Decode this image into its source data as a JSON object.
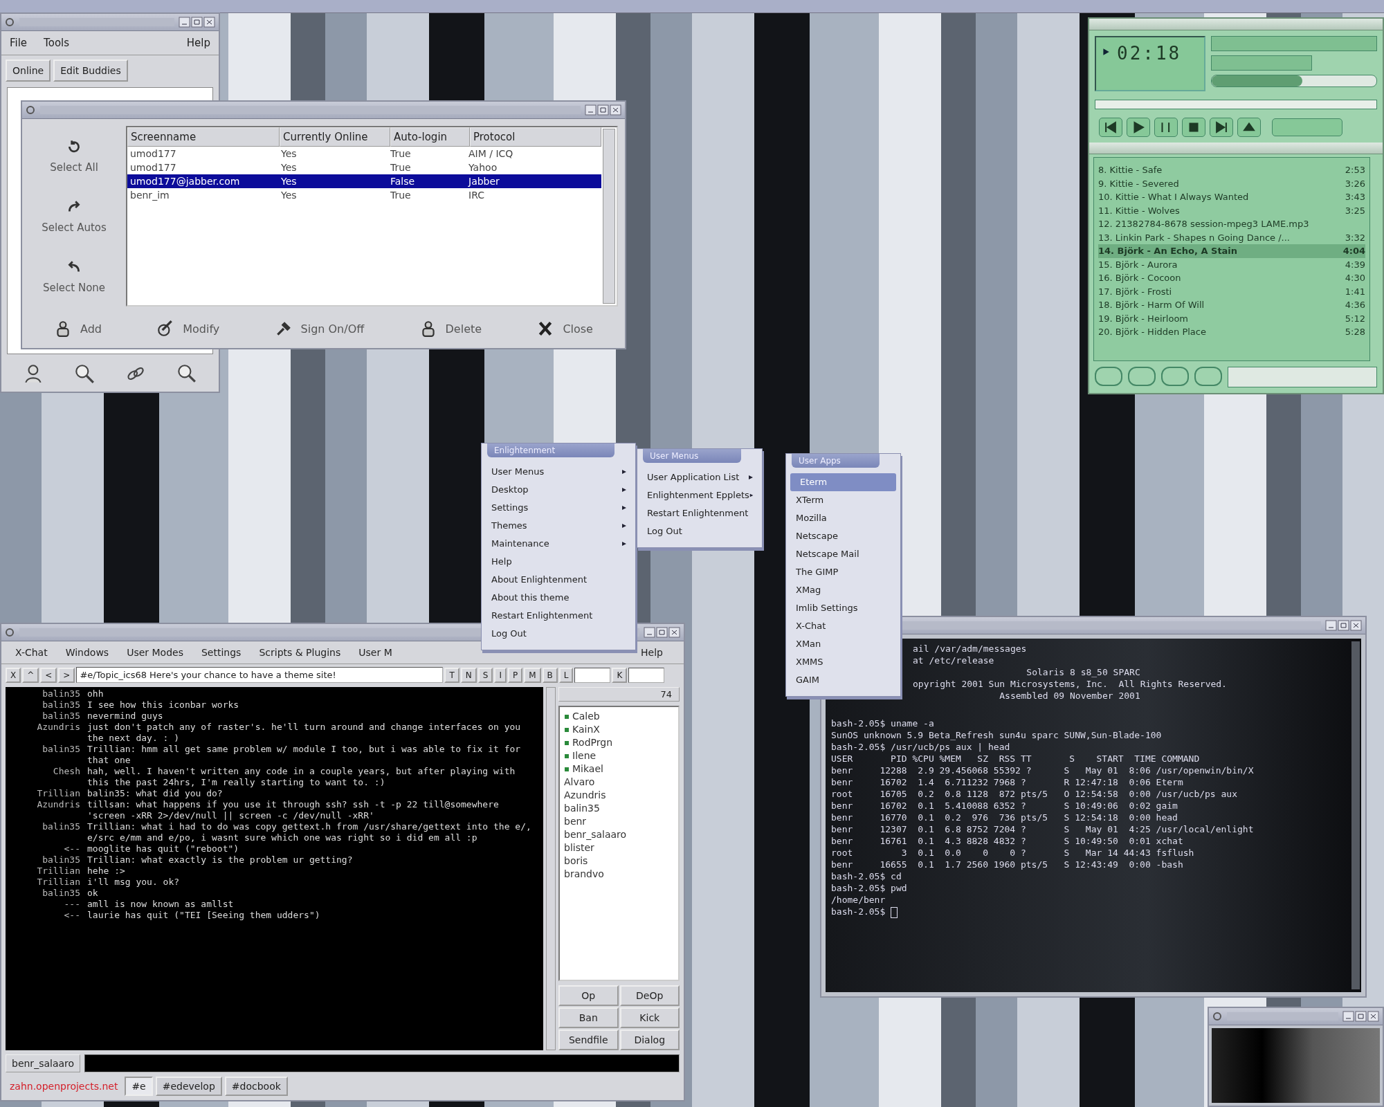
{
  "buddy_list": {
    "menu": [
      "File",
      "Tools",
      "Help"
    ],
    "buttons": [
      "Online",
      "Edit Buddies"
    ]
  },
  "account_editor": {
    "side_buttons": [
      "Select All",
      "Select Autos",
      "Select None"
    ],
    "columns": [
      "Screenname",
      "Currently Online",
      "Auto-login",
      "Protocol"
    ],
    "rows": [
      {
        "cells": [
          "umod177",
          "Yes",
          "True",
          "AIM / ICQ"
        ],
        "selected": false
      },
      {
        "cells": [
          "umod177",
          "Yes",
          "True",
          "Yahoo"
        ],
        "selected": false
      },
      {
        "cells": [
          "umod177@jabber.com",
          "Yes",
          "False",
          "Jabber"
        ],
        "selected": true
      },
      {
        "cells": [
          "benr_im",
          "Yes",
          "True",
          "IRC"
        ],
        "selected": false
      }
    ],
    "buttons": [
      "Add",
      "Modify",
      "Sign On/Off",
      "Delete",
      "Close"
    ]
  },
  "player": {
    "time": "02:18",
    "volume": {
      "level": 0.55
    },
    "playlist": [
      {
        "title": "8. Kittie - Safe",
        "length": "2:53",
        "selected": false
      },
      {
        "title": "9. Kittie - Severed",
        "length": "3:26",
        "selected": false
      },
      {
        "title": "10. Kittie - What I Always Wanted",
        "length": "3:43",
        "selected": false
      },
      {
        "title": "11. Kittie - Wolves",
        "length": "3:25",
        "selected": false
      },
      {
        "title": "12. 21382784-8678 session-mpeg3 LAME.mp3",
        "selected": false
      },
      {
        "title": "13. Linkin Park - Shapes n Going Dance /...",
        "length": "3:32",
        "selected": false
      },
      {
        "title": "14. Björk - An Echo, A Stain",
        "length": "4:04",
        "selected": true
      },
      {
        "title": "15. Björk - Aurora",
        "length": "4:39",
        "selected": false
      },
      {
        "title": "16. Björk - Cocoon",
        "length": "4:30",
        "selected": false
      },
      {
        "title": "17. Björk - Frosti",
        "length": "1:41",
        "selected": false
      },
      {
        "title": "18. Björk - Harm Of Will",
        "length": "4:36",
        "selected": false
      },
      {
        "title": "19. Björk - Heirloom",
        "length": "5:12",
        "selected": false
      },
      {
        "title": "20. Björk - Hidden Place",
        "length": "5:28",
        "selected": false
      }
    ]
  },
  "menus": [
    {
      "title": "Enlightenment",
      "items": [
        {
          "label": "User Menus",
          "has_submenu": true,
          "selected": false
        },
        {
          "label": "Desktop",
          "has_submenu": true,
          "selected": false
        },
        {
          "label": "Settings",
          "has_submenu": true,
          "selected": false
        },
        {
          "label": "Themes",
          "has_submenu": true,
          "selected": false
        },
        {
          "label": "Maintenance",
          "has_submenu": true,
          "selected": false
        },
        {
          "label": "Help",
          "has_submenu": false,
          "selected": false
        },
        {
          "label": "About Enlightenment",
          "has_submenu": false,
          "selected": false
        },
        {
          "label": "About this theme",
          "has_submenu": false,
          "selected": false
        },
        {
          "label": "Restart Enlightenment",
          "has_submenu": false,
          "selected": false
        },
        {
          "label": "Log Out",
          "has_submenu": false,
          "selected": false
        }
      ]
    },
    {
      "title": "User Menus",
      "items": [
        {
          "label": "User Application List",
          "has_submenu": true,
          "selected": false
        },
        {
          "label": "Enlightenment Epplets",
          "has_submenu": true,
          "selected": false
        },
        {
          "label": "Restart Enlightenment",
          "has_submenu": false,
          "selected": false
        },
        {
          "label": "Log Out",
          "has_submenu": false,
          "selected": false
        }
      ]
    },
    {
      "title": "User Apps",
      "items": [
        {
          "label": "Eterm",
          "has_submenu": false,
          "selected": true
        },
        {
          "label": "XTerm",
          "has_submenu": false,
          "selected": false
        },
        {
          "label": "Mozilla",
          "has_submenu": false,
          "selected": false
        },
        {
          "label": "Netscape",
          "has_submenu": false,
          "selected": false
        },
        {
          "label": "Netscape Mail",
          "has_submenu": false,
          "selected": false
        },
        {
          "label": "The GIMP",
          "has_submenu": false,
          "selected": false
        },
        {
          "label": "XMag",
          "has_submenu": false,
          "selected": false
        },
        {
          "label": "Imlib Settings",
          "has_submenu": false,
          "selected": false
        },
        {
          "label": "X-Chat",
          "has_submenu": false,
          "selected": false
        },
        {
          "label": "XMan",
          "has_submenu": false,
          "selected": false
        },
        {
          "label": "XMMS",
          "has_submenu": false,
          "selected": false
        },
        {
          "label": "GAIM",
          "has_submenu": false,
          "selected": false
        }
      ]
    }
  ],
  "xchat": {
    "menu": [
      "X-Chat",
      "Windows",
      "User Modes",
      "Settings",
      "Scripts & Plugins",
      "User M"
    ],
    "help": "Help",
    "nav_buttons": [
      "X",
      "^",
      "<",
      ">"
    ],
    "topic": "#e/Topic_ics68   Here's your chance to have a theme site!",
    "mode_buttons": [
      "T",
      "N",
      "S",
      "I",
      "P",
      "M",
      "B",
      "L"
    ],
    "key_button": "K",
    "messages": [
      {
        "nick": "balin35",
        "text": "ohh"
      },
      {
        "nick": "balin35",
        "text": "I see how this iconbar works"
      },
      {
        "nick": "balin35",
        "text": "nevermind guys"
      },
      {
        "nick": "Azundris",
        "text": "just don't patch any of raster's. he'll turn around and change interfaces on you the next day. : )"
      },
      {
        "nick": "balin35",
        "text": "Trillian: hmm all get same problem w/ module I too, but i was able to fix it for that one"
      },
      {
        "nick": "Chesh",
        "text": "hah, well. I haven't written any code in a couple years, but after playing with this the past 24hrs, I'm really starting to want to. :)"
      },
      {
        "nick": "Trillian",
        "text": "balin35: what did you do?"
      },
      {
        "nick": "Azundris",
        "text": "tillsan: what happens if you use it through ssh?  ssh -t -p 22 till@somewhere 'screen -xRR 2>/dev/null || screen -c /dev/null -xRR'"
      },
      {
        "nick": "balin35",
        "text": "Trillian: what i had to do was copy gettext.h from /usr/share/gettext into the e/, e/src e/mm and e/po, i wasnt sure which one was right so i did em all :p"
      },
      {
        "nick": "<--",
        "text": "mooglite has quit (\"reboot\")"
      },
      {
        "nick": "balin35",
        "text": "Trillian: what exactly is the problem ur getting?"
      },
      {
        "nick": "Trillian",
        "text": "hehe :>"
      },
      {
        "nick": "Trillian",
        "text": "i'll msg you. ok?"
      },
      {
        "nick": "balin35",
        "text": "ok"
      },
      {
        "nick": "---",
        "text": "amll is now known as amllst"
      },
      {
        "nick": "<--",
        "text": "laurie has quit (\"TEI [Seeing them udders\")"
      }
    ],
    "user_count": "74",
    "users": [
      {
        "name": "Caleb",
        "op": true
      },
      {
        "name": "KainX",
        "op": true
      },
      {
        "name": "RodPrgn",
        "op": true
      },
      {
        "name": "Ilene",
        "op": true
      },
      {
        "name": "Mikael",
        "op": true
      },
      {
        "name": "Alvaro",
        "op": false
      },
      {
        "name": "Azundris",
        "op": false
      },
      {
        "name": "balin35",
        "op": false
      },
      {
        "name": "benr",
        "op": false
      },
      {
        "name": "benr_salaaro",
        "op": false
      },
      {
        "name": "blister",
        "op": false
      },
      {
        "name": "boris",
        "op": false
      },
      {
        "name": "brandvo",
        "op": false
      }
    ],
    "user_buttons": [
      "Op",
      "DeOp",
      "Ban",
      "Kick",
      "Sendfile",
      "Dialog"
    ],
    "nick": "benr_salaaro",
    "server": "zahn.openprojects.net",
    "channels": [
      {
        "label": "#e",
        "selected": true
      },
      {
        "label": "#edevelop",
        "selected": false
      },
      {
        "label": "#docbook",
        "selected": false
      }
    ]
  },
  "terminal": {
    "header_lines": [
      "ail /var/adm/messages",
      "at /etc/release",
      "                     Solaris 8 s8_50 SPARC",
      "opyright 2001 Sun Microsystems, Inc.  All Rights Reserved.",
      "                Assembled 09 November 2001"
    ],
    "lines": [
      "bash-2.05$ uname -a",
      "SunOS unknown 5.9 Beta_Refresh sun4u sparc SUNW,Sun-Blade-100",
      "bash-2.05$ /usr/ucb/ps aux | head",
      "USER       PID %CPU %MEM   SZ  RSS TT       S    START  TIME COMMAND",
      "benr     12288  2.9 29.456068 55392 ?      S   May 01  8:06 /usr/openwin/bin/X",
      "benr     16702  1.4  6.711232 7968 ?       R 12:47:18  0:06 Eterm",
      "root     16705  0.2  0.8 1128  872 pts/5   O 12:54:58  0:00 /usr/ucb/ps aux",
      "benr     16702  0.1  5.410088 6352 ?       S 10:49:06  0:02 gaim",
      "benr     16770  0.1  0.2  976  736 pts/5   S 12:54:18  0:00 head",
      "benr     12307  0.1  6.8 8752 7204 ?       S   May 01  4:25 /usr/local/enlight",
      "benr     16761  0.1  4.3 8828 4832 ?       S 10:49:50  0:01 xchat",
      "root         3  0.1  0.0    0    0 ?       S   Mar 14 44:43 fsflush",
      "benr     16655  0.1  1.7 2560 1960 pts/5   S 12:43:49  0:00 -bash",
      "bash-2.05$ cd",
      "bash-2.05$ pwd",
      "/home/benr",
      "bash-2.05$ "
    ]
  }
}
